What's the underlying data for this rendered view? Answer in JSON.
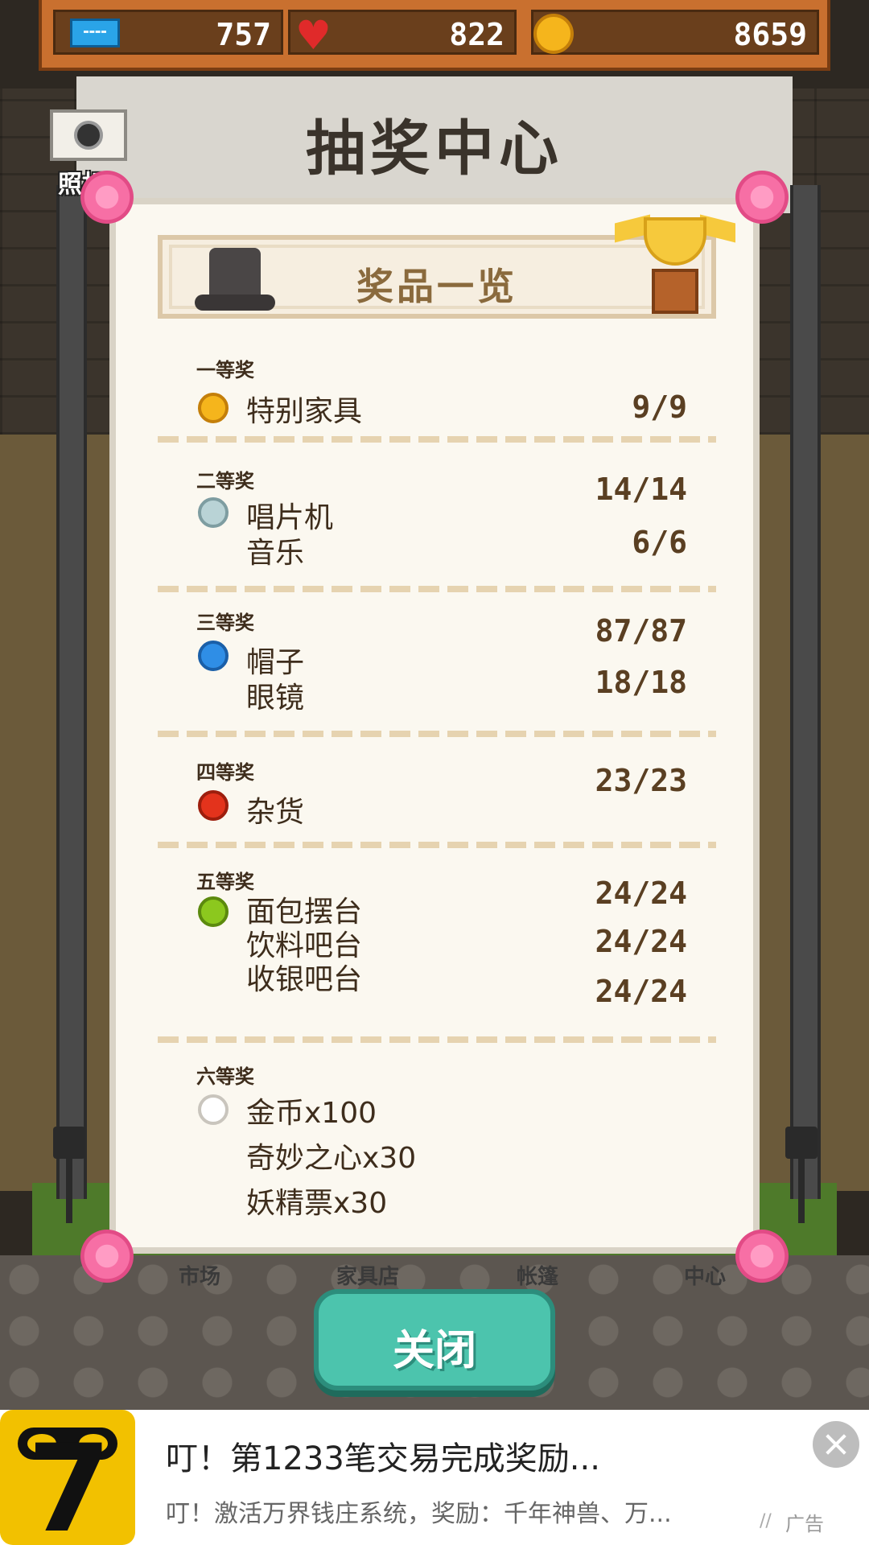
{
  "resources": {
    "tickets": "757",
    "hearts": "822",
    "coins": "8659"
  },
  "background": {
    "building_title": "抽奖中心",
    "nav_labels": [
      "市场",
      "家具店",
      "帐篷",
      "中心"
    ]
  },
  "camera": {
    "label": "照相"
  },
  "panel": {
    "title": "奖品一览",
    "tiers": [
      {
        "label": "一等奖",
        "gem_color": "#f5b51c",
        "items": [
          "特别家具"
        ],
        "counts": [
          "9/9"
        ]
      },
      {
        "label": "二等奖",
        "gem_color": "#b9d3d6",
        "items": [
          "唱片机",
          "音乐"
        ],
        "counts": [
          "14/14",
          "6/6"
        ]
      },
      {
        "label": "三等奖",
        "gem_color": "#2f8ee6",
        "items": [
          "帽子",
          "眼镜"
        ],
        "counts": [
          "87/87",
          "18/18"
        ]
      },
      {
        "label": "四等奖",
        "gem_color": "#e3331c",
        "items": [
          "杂货"
        ],
        "counts": [
          "23/23"
        ]
      },
      {
        "label": "五等奖",
        "gem_color": "#8cc81e",
        "items": [
          "面包摆台",
          "饮料吧台",
          "收银吧台"
        ],
        "counts": [
          "24/24",
          "24/24",
          "24/24"
        ]
      },
      {
        "label": "六等奖",
        "gem_color": "#ffffff",
        "items": [
          "金币x100",
          "奇妙之心x30",
          "妖精票x30"
        ],
        "counts": []
      }
    ]
  },
  "close_button": {
    "label": "关闭"
  },
  "ad": {
    "title": "叮！第1233笔交易完成奖励...",
    "description": "叮！激活万界钱庄系统，奖励：千年神兽、万...",
    "tag": "广告"
  },
  "icons": {
    "ticket": "ticket-icon",
    "heart": "heart-icon",
    "coin": "coin-icon",
    "camera": "camera-icon",
    "hat": "hat-icon",
    "trophy": "trophy-icon",
    "ad_close": "close-icon"
  }
}
